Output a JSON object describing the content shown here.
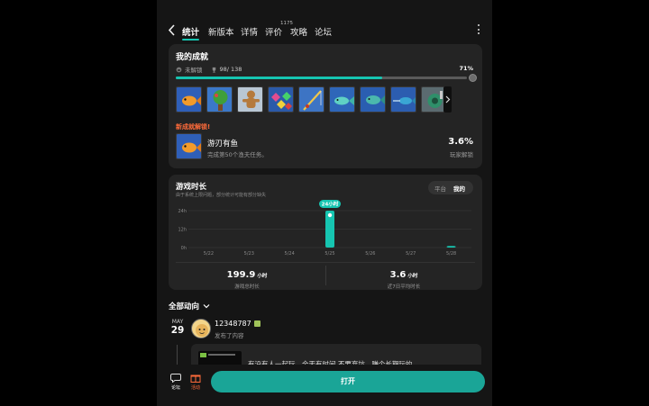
{
  "nav": {
    "tabs": [
      {
        "label": "统计",
        "active": true
      },
      {
        "label": "新版本",
        "active": false
      },
      {
        "label": "详情",
        "active": false
      },
      {
        "label": "评价",
        "active": false,
        "sup": "1175"
      },
      {
        "label": "攻略",
        "active": false
      },
      {
        "label": "论坛",
        "active": false
      }
    ]
  },
  "achievements": {
    "title": "我的成就",
    "locked_label": "未解锁",
    "count": "98/ 138",
    "percent_text": "71%",
    "progress": 0.71,
    "new_label": "新成就解锁!",
    "new_name": "游刃有鱼",
    "new_desc": "完成第50个渔夫任务。",
    "new_pct": "3.6%",
    "new_pct_label": "玩家解锁"
  },
  "playtime": {
    "title": "游戏时长",
    "note": "由于系统上限问题，部分统计可能有部分缺失",
    "segments": [
      "平台",
      "我的"
    ],
    "tooltip": "24小时",
    "total_value": "199.9",
    "total_unit": "小时",
    "total_label": "游戏总时长",
    "avg_value": "3.6",
    "avg_unit": "小时",
    "avg_label": "近7日平均时长"
  },
  "chart_data": {
    "type": "bar",
    "categories": [
      "5/22",
      "5/23",
      "5/24",
      "5/25",
      "5/26",
      "5/27",
      "5/28"
    ],
    "values": [
      0,
      0,
      0,
      24,
      0,
      0,
      1
    ],
    "yticks": [
      "24h",
      "12h",
      "0h"
    ],
    "ylim": [
      0,
      24
    ],
    "highlight_label": "24小时",
    "color": "#16c5b1"
  },
  "feed": {
    "title": "全部动向",
    "month": "MAY",
    "day": "29",
    "username": "12348787",
    "action": "发布了内容",
    "post_text": "有没有人一起玩，全天有时间 不要弃坑，赚个长期玩的"
  },
  "bottom": {
    "forum_label": "论坛",
    "gift_label": "活动",
    "open_label": "打开"
  },
  "colors": {
    "accent": "#16c5b1",
    "new": "#ff6b3a",
    "button": "#1aa597"
  }
}
